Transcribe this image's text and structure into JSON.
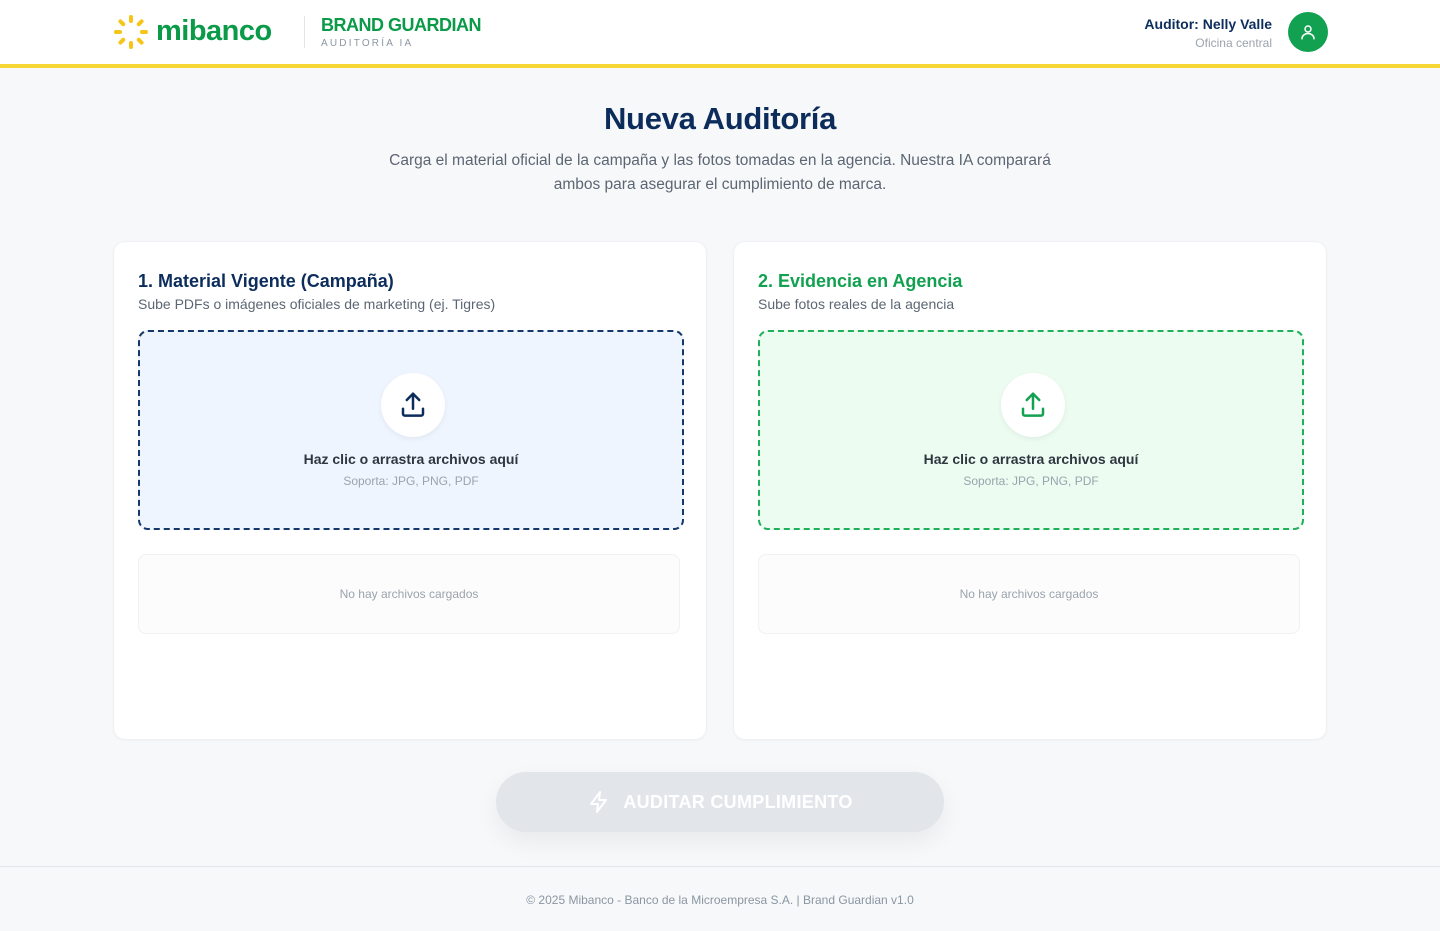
{
  "header": {
    "logo_text": "mibanco",
    "product_title": "BRAND GUARDIAN",
    "product_subtitle": "AUDITORÍA IA",
    "user_name": "Auditor: Nelly Valle",
    "user_office": "Oficina central",
    "avatar_icon": "user-icon"
  },
  "hero": {
    "title": "Nueva Auditoría",
    "description": "Carga el material oficial de la campaña y las fotos tomadas en la agencia. Nuestra IA comparará ambos para asegurar el cumplimiento de marca."
  },
  "panels": [
    {
      "title": "1. Material Vigente (Campaña)",
      "subtitle": "Sube PDFs o imágenes oficiales de marketing (ej. Tigres)",
      "dropzone_title": "Haz clic o arrastra archivos aquí",
      "dropzone_formats": "Soporta: JPG, PNG, PDF",
      "empty_state": "No hay archivos cargados",
      "icon": "upload-icon",
      "accent": "#0c2d5c"
    },
    {
      "title": "2. Evidencia en Agencia",
      "subtitle": "Sube fotos reales de la agencia",
      "dropzone_title": "Haz clic o arrastra archivos aquí",
      "dropzone_formats": "Soporta: JPG, PNG, PDF",
      "empty_state": "No hay archivos cargados",
      "icon": "upload-icon",
      "accent": "#12a150"
    }
  ],
  "action": {
    "label": "AUDITAR CUMPLIMIENTO",
    "icon": "lightning-icon",
    "disabled": true
  },
  "footer": {
    "text": "© 2025 Mibanco - Banco de la Microempresa S.A. | Brand Guardian v1.0"
  },
  "colors": {
    "brand_green": "#12a150",
    "brand_navy": "#0c2d5c",
    "brand_yellow": "#f5d634"
  }
}
